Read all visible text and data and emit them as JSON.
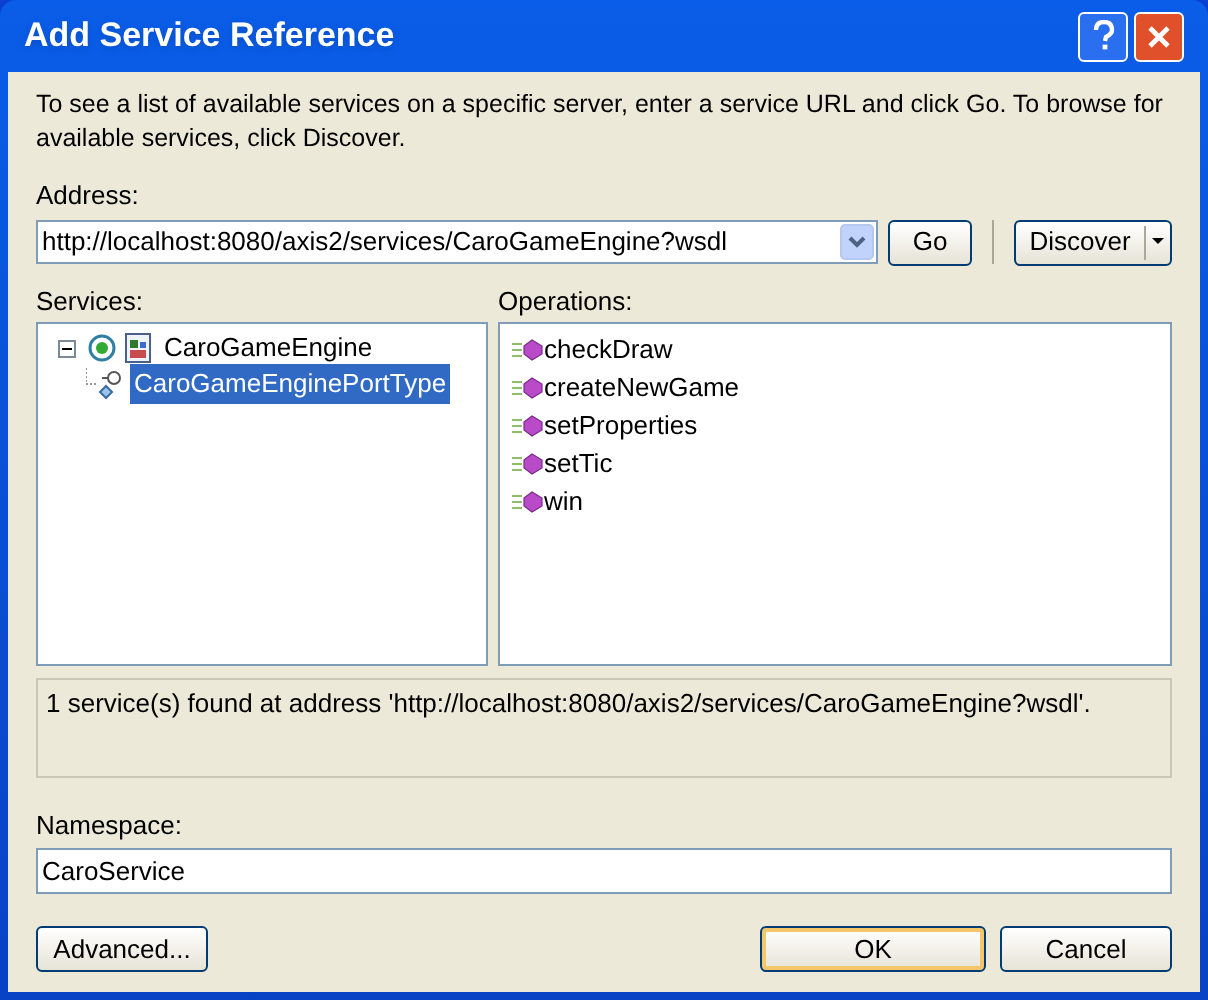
{
  "window": {
    "title": "Add Service Reference"
  },
  "description": "To see a list of available services on a specific server, enter a service URL and click Go. To browse for available services, click Discover.",
  "address": {
    "label": "Address:",
    "value": "http://localhost:8080/axis2/services/CaroGameEngine?wsdl"
  },
  "go_button": "Go",
  "discover_button": "Discover",
  "services": {
    "label": "Services:",
    "items": [
      {
        "label": "CaroGameEngine",
        "expanded": true,
        "selected": false,
        "children": [
          {
            "label": "CaroGameEnginePortType",
            "selected": true
          }
        ]
      }
    ]
  },
  "operations": {
    "label": "Operations:",
    "items": [
      "checkDraw",
      "createNewGame",
      "setProperties",
      "setTic",
      "win"
    ]
  },
  "status": "1 service(s) found at address 'http://localhost:8080/axis2/services/CaroGameEngine?wsdl'.",
  "namespace": {
    "label": "Namespace:",
    "value": "CaroService"
  },
  "buttons": [
    {
      "label": "Advanced...",
      "kind": "secondary"
    },
    {
      "label": "OK",
      "kind": "default"
    },
    {
      "label": "Cancel",
      "kind": "secondary"
    }
  ]
}
